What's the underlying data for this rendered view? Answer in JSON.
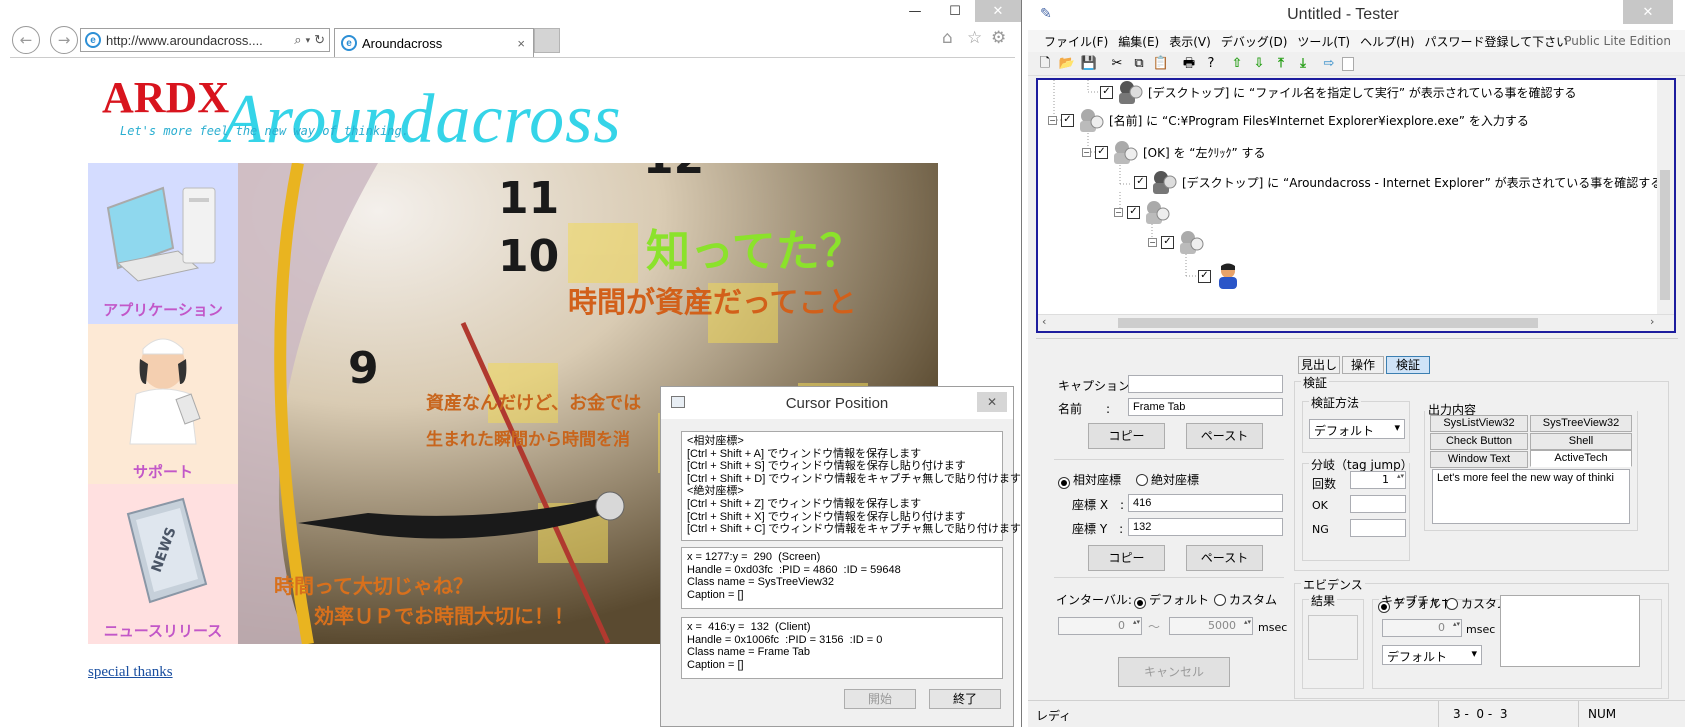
{
  "ie": {
    "url": "http://www.aroundacross....",
    "tab_title": "Aroundacross",
    "window_controls": {
      "minimize": "—",
      "maximize": "☐",
      "close": "✕"
    },
    "site": {
      "logo_text": "ARDX",
      "logo_script": "Aroundacross",
      "tagline": "Let's more feel the new way of thinking.",
      "side_items": [
        {
          "label": "アプリケーション"
        },
        {
          "label": "サポート"
        },
        {
          "label": "ニュースリリース"
        }
      ],
      "hero": {
        "headline": "知ってた？",
        "subhead": "時間が資産だってこと",
        "line1": "資産なんだけど、お金では",
        "line2": "生まれた瞬間から時間を消",
        "line3": "時間って大切じゃね？",
        "line4": "効率ＵＰでお時間大切に！！",
        "clock_numbers": [
          "11",
          "10",
          "9",
          "12"
        ]
      },
      "footer_link": "special thanks"
    },
    "cursor_dialog": {
      "title": "Cursor Position",
      "help_text": "<相対座標>\n[Ctrl + Shift + A] でウィンドウ情報を保存します\n[Ctrl + Shift + S] でウィンドウ情報を保存し貼り付けます\n[Ctrl + Shift + D] でウィンドウ情報をキャプチャ無しで貼り付けます\n<絶対座標>\n[Ctrl + Shift + Z] でウィンドウ情報を保存します\n[Ctrl + Shift + X] でウィンドウ情報を保存し貼り付けます\n[Ctrl + Shift + C] でウィンドウ情報をキャプチャ無しで貼り付けます",
      "screen_info": "x = 1277:y =  290  (Screen)\nHandle = 0xd03fc  :PID = 4860  :ID = 59648\nClass name = SysTreeView32\nCaption = []",
      "client_info": "x =  416:y =  132  (Client)\nHandle = 0x1006fc  :PID = 3156  :ID = 0\nClass name = Frame Tab\nCaption = []",
      "start_button": "開始",
      "end_button": "終了"
    }
  },
  "tester": {
    "title": "Untitled - Tester",
    "edition": "Public Lite Edition",
    "menu": [
      "ファイル(F)",
      "編集(E)",
      "表示(V)",
      "デバッグ(D)",
      "ツール(T)",
      "ヘルプ(H)",
      "パスワード登録して下さい"
    ],
    "toolbar_icons": [
      "new-file-icon",
      "open-folder-icon",
      "save-icon",
      "cut-icon",
      "copy-icon",
      "paste-icon",
      "print-icon",
      "help-icon",
      "arrow-up-icon",
      "arrow-down-icon",
      "arrow-top-icon",
      "arrow-bottom-icon",
      "export-icon",
      "blank-icon"
    ],
    "tree": [
      {
        "text": "[デスクトップ] に “ファイル名を指定して実行” が表示されている事を確認する"
      },
      {
        "text": "[名前] に “C:¥Program Files¥Internet Explorer¥iexplore.exe” を入力する"
      },
      {
        "text": "[OK] を “左ｸﾘｯｸ” する"
      },
      {
        "text": "[デスクトップ] に “Aroundacross - Internet Explorer” が表示されている事を確認する"
      },
      {
        "text": ""
      },
      {
        "text": ""
      },
      {
        "text": ""
      }
    ],
    "panel_tabs": [
      "見出し",
      "操作",
      "検証"
    ],
    "caption_label": "キャプション:",
    "caption_value": "",
    "name_label": "名前　　:",
    "name_value": "Frame Tab",
    "copy_label": "コピー",
    "paste_label": "ペースト",
    "relative_label": "相対座標",
    "absolute_label": "絶対座標",
    "coord_x_label": "座標 X　:",
    "coord_x": "416",
    "coord_y_label": "座標 Y　:",
    "coord_y": "132",
    "interval_label": "インターバル:",
    "default_label": "デフォルト",
    "custom_label": "カスタム",
    "interval_from": "0",
    "interval_tilde": "～",
    "interval_to": "5000",
    "msec": "msec",
    "cancel_label": "キャンセル",
    "verify_group": "検証",
    "verify_method_group": "検証方法",
    "verify_method_value": "デフォルト",
    "branch_group": "分岐（tag jump）",
    "count_label": "回数",
    "count_value": "1",
    "ok_label": "OK",
    "ng_label": "NG",
    "output_group": "出力内容",
    "output_tabs": [
      "SysListView32",
      "SysTreeView32",
      "Check Button",
      "Shell",
      "Window Text",
      "ActiveTech"
    ],
    "output_text": "Let's more feel the new way of thinki",
    "evidence_group": "エビデンス",
    "result_label": "結果",
    "capture_group": "キャプチャー",
    "capture_spin": "0",
    "capture_select": "デフォルト",
    "status": {
      "ready": "レディ",
      "position": "3 -  0 -  3",
      "num": "NUM"
    }
  }
}
